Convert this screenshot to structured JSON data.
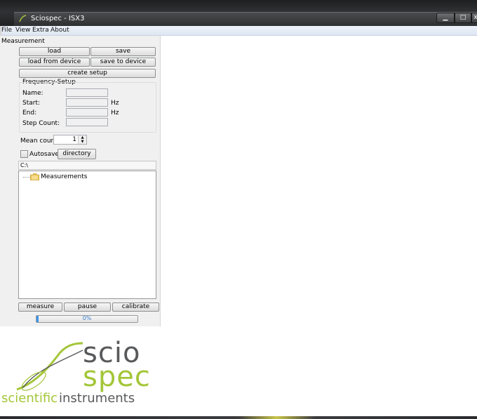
{
  "window": {
    "title": "Sciospec - ISX3",
    "minimize_glyph": "▁",
    "maximize_glyph": "□",
    "close_glyph": "x"
  },
  "menu": [
    "File",
    "View",
    "Extra",
    "About"
  ],
  "measurement": {
    "section_label": "Measurement",
    "load": "load",
    "save": "save",
    "load_from_device": "load from device",
    "save_to_device": "save to device",
    "create_setup": "create setup"
  },
  "frequency_setup": {
    "label": "Frequency-Setup",
    "name_label": "Name:",
    "start_label": "Start:",
    "end_label": "End:",
    "step_count_label": "Step Count:",
    "name_value": "",
    "start_value": "",
    "end_value": "",
    "step_count_value": "",
    "start_unit": "Hz",
    "end_unit": "Hz"
  },
  "mean_count": {
    "label": "Mean count",
    "value": "1"
  },
  "autosave": {
    "label": "Autosave",
    "checked": false,
    "directory_button": "directory"
  },
  "file_browser": {
    "path": "C:\\",
    "items": [
      "Measurements"
    ]
  },
  "actions": {
    "measure": "measure",
    "pause": "pause",
    "calibrate": "calibrate"
  },
  "progress": {
    "text": "0%",
    "value": 0.0
  },
  "logo": {
    "line1": "scio",
    "line2": "spec",
    "tagline_part1": "scientific",
    "tagline_part2": "instruments"
  },
  "colors": {
    "brand_green": "#a4c639",
    "brand_gray": "#58595b",
    "progress_blue": "#3d95e8"
  }
}
